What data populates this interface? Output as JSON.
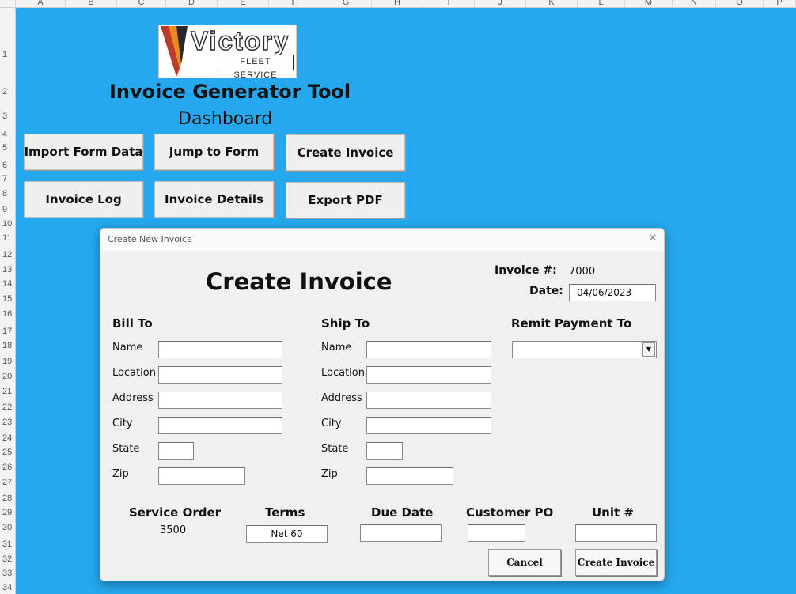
{
  "spreadsheet": {
    "columns": [
      "A",
      "B",
      "C",
      "D",
      "E",
      "F",
      "G",
      "H",
      "I",
      "J",
      "K",
      "L",
      "M",
      "N",
      "O",
      "P"
    ],
    "rows": [
      "1",
      "2",
      "3",
      "4",
      "5",
      "6",
      "7",
      "8",
      "9",
      "10",
      "11",
      "12",
      "13",
      "14",
      "15",
      "16",
      "17",
      "18",
      "19",
      "20",
      "21",
      "22",
      "23",
      "24",
      "25",
      "26",
      "27",
      "28",
      "29",
      "30",
      "31",
      "32",
      "33",
      "34"
    ],
    "background_color": "#25a8ee"
  },
  "logo": {
    "wordmark": "Victory",
    "tagline": "FLEET SERVICE",
    "colors": {
      "red": "#c0392b",
      "orange": "#e88a1e",
      "dark": "#2a2a2a"
    }
  },
  "dashboard": {
    "title": "Invoice Generator Tool",
    "subtitle": "Dashboard",
    "buttons": {
      "import_form_data": "Import Form Data",
      "jump_to_form": "Jump to Form",
      "create_invoice": "Create Invoice",
      "invoice_log": "Invoice Log",
      "invoice_details": "Invoice Details",
      "export_pdf": "Export PDF"
    }
  },
  "dialog": {
    "window_title": "Create New Invoice",
    "close_glyph": "✕",
    "heading": "Create Invoice",
    "invoice_number_label": "Invoice #:",
    "invoice_number_value": "7000",
    "date_label": "Date:",
    "date_value": "04/06/2023",
    "bill_to": {
      "heading": "Bill To",
      "labels": {
        "name": "Name",
        "location": "Location",
        "address": "Address",
        "city": "City",
        "state": "State",
        "zip": "Zip"
      },
      "values": {
        "name": "",
        "location": "",
        "address": "",
        "city": "",
        "state": "",
        "zip": ""
      }
    },
    "ship_to": {
      "heading": "Ship To",
      "labels": {
        "name": "Name",
        "location": "Location",
        "address": "Address",
        "city": "City",
        "state": "State",
        "zip": "Zip"
      },
      "values": {
        "name": "",
        "location": "",
        "address": "",
        "city": "",
        "state": "",
        "zip": ""
      }
    },
    "remit": {
      "heading": "Remit Payment To",
      "selected": "",
      "arrow_glyph": "▼"
    },
    "footer_fields": {
      "service_order_label": "Service Order",
      "service_order_value": "3500",
      "terms_label": "Terms",
      "terms_value": "Net 60",
      "due_date_label": "Due Date",
      "due_date_value": "",
      "customer_po_label": "Customer PO",
      "customer_po_value": "",
      "unit_label": "Unit #",
      "unit_value": ""
    },
    "buttons": {
      "cancel": "Cancel",
      "create_invoice": "Create Invoice"
    }
  }
}
